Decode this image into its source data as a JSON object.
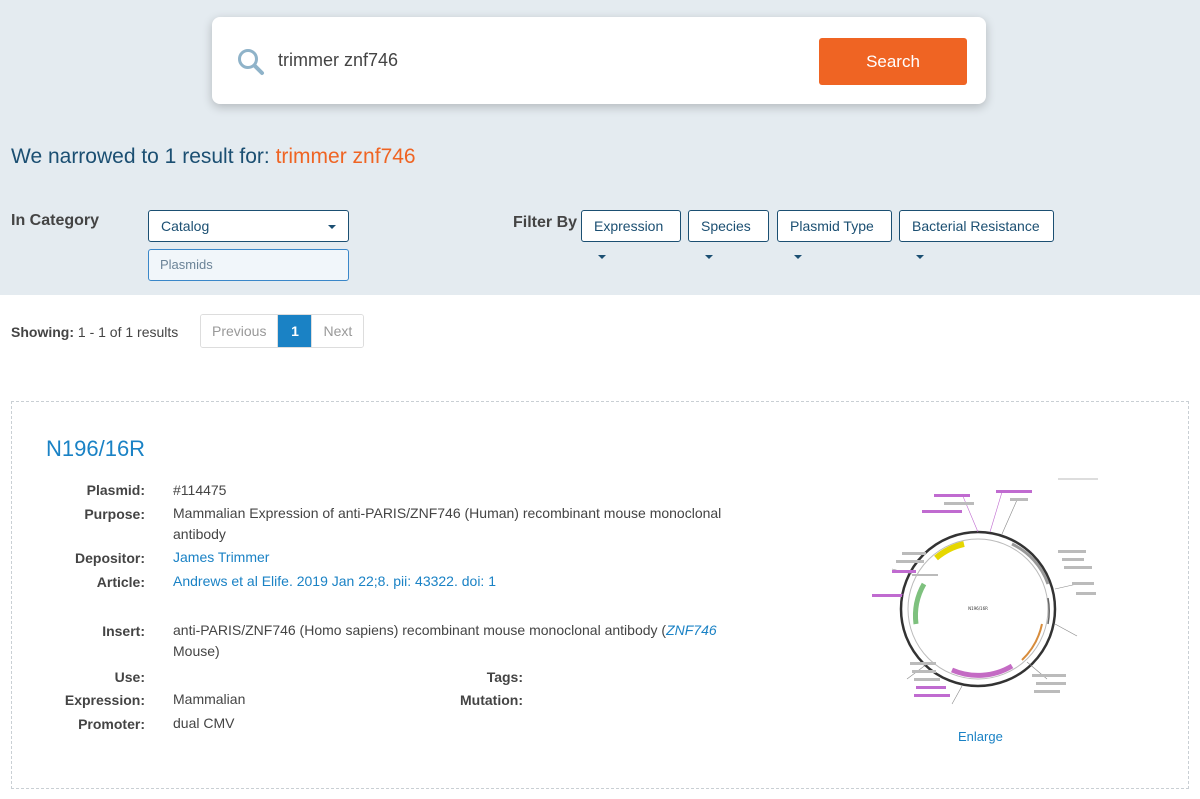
{
  "search": {
    "value": "trimmer znf746",
    "button_label": "Search",
    "icon": "search-icon"
  },
  "results_header": {
    "prefix": "We narrowed to 1 result for: ",
    "query": "trimmer znf746"
  },
  "category": {
    "label": "In Category",
    "selected": "Catalog",
    "sub_selected": "Plasmids"
  },
  "filters": {
    "label": "Filter By",
    "options": [
      "Expression",
      "Species",
      "Plasmid Type",
      "Bacterial Resistance"
    ]
  },
  "pagination": {
    "showing_label": "Showing:",
    "showing_range": " 1 - 1 of 1 results",
    "previous": "Previous",
    "current": "1",
    "next": "Next"
  },
  "result": {
    "title": "N196/16R",
    "plasmid_label": "Plasmid:",
    "plasmid_value": "#114475",
    "purpose_label": "Purpose:",
    "purpose_value": "Mammalian Expression of anti-PARIS/ZNF746 (Human) recombinant mouse monoclonal antibody",
    "depositor_label": "Depositor:",
    "depositor_value": "James Trimmer",
    "article_label": "Article:",
    "article_value": "Andrews et al Elife. 2019 Jan 22;8. pii: 43322. doi: 1",
    "insert_label": "Insert:",
    "insert_value_prefix": "anti-PARIS/ZNF746 (Homo sapiens) recombinant mouse monoclonal antibody (",
    "insert_gene": "ZNF746",
    "insert_value_suffix": "Mouse)",
    "use_label": "Use:",
    "use_value": "",
    "tags_label": "Tags:",
    "tags_value": "",
    "expression_label": "Expression:",
    "expression_value": "Mammalian",
    "mutation_label": "Mutation:",
    "mutation_value": "",
    "promoter_label": "Promoter:",
    "promoter_value": "dual CMV",
    "map_center_label": "N196/16R",
    "enlarge_label": "Enlarge"
  },
  "colors": {
    "accent": "#ef6423",
    "link": "#1a82c5",
    "heading": "#1b4f72",
    "band": "#e4ebf0"
  }
}
